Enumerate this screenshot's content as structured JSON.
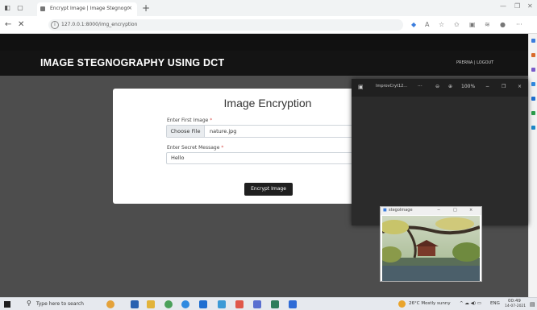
{
  "browser": {
    "tab_title": "Encrypt Image | Image Stegnogr",
    "tab_close": "×",
    "new_tab": "+",
    "url": "127.0.0.1:8000/img_encryption"
  },
  "site": {
    "brand": "IMAGE STEGNOGRAPHY USING DCT",
    "user_links": "PRERNA | LOGOUT"
  },
  "form": {
    "title": "Image Encryption",
    "image_label": "Enter First Image",
    "required_mark": "*",
    "choose_file_label": "Choose File",
    "file_name": "nature.jpg",
    "message_label": "Enter Secret Message",
    "message_value": "Hello",
    "submit_label": "Encrypt Image"
  },
  "viewer": {
    "filename": "ImprovCryt12...",
    "more": "···",
    "zoom_out": "⊖",
    "zoom_in": "⊕",
    "zoom": "100%",
    "minimize": "−",
    "maximize": "❐",
    "close": "×"
  },
  "stego_window": {
    "title": "stegoImage",
    "minimize": "−",
    "maximize": "□",
    "close": "×"
  },
  "taskbar": {
    "search_placeholder": "Type here to search",
    "weather": "26°C  Mostly sunny",
    "language": "ENG",
    "time": "00:49",
    "date": "14-07-2021"
  },
  "colors": {
    "header_bg": "#141414",
    "page_bg": "#4d4d4d",
    "button_bg": "#1f1f1f",
    "required": "#d9534f"
  }
}
